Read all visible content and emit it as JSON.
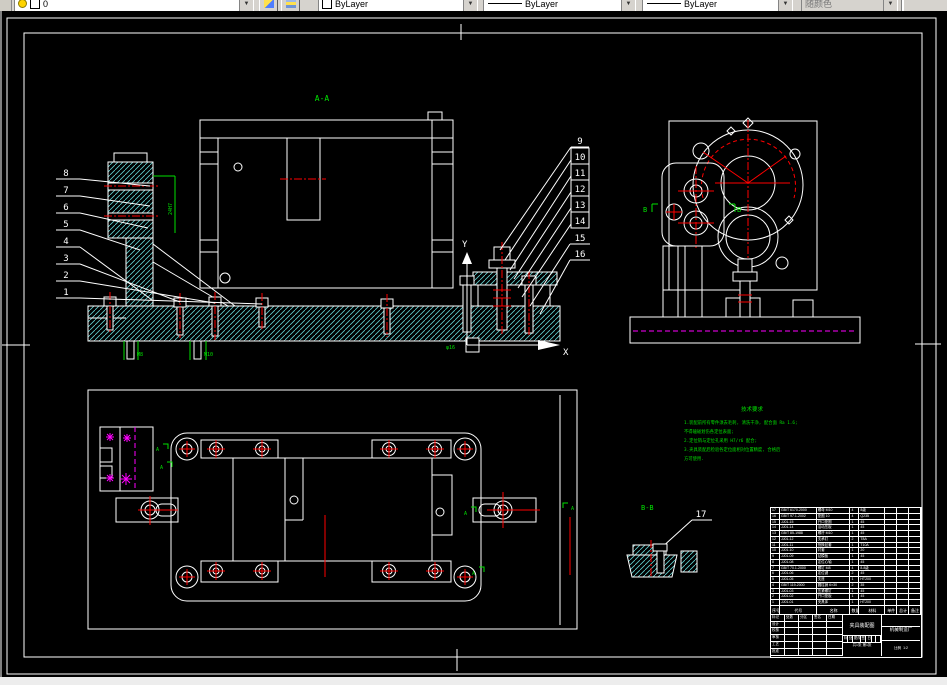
{
  "toolbar": {
    "layer_value": "0",
    "color_value": "ByLayer",
    "linetype_value": "ByLayer",
    "lineweight_value": "ByLayer",
    "plotstyle_value": "随颜色"
  },
  "labels": {
    "section_front": "A-A",
    "section_detail": "B-B",
    "axis_x": "X",
    "axis_y": "Y",
    "side_section": "B",
    "plan_section": "A"
  },
  "balloons": {
    "left": [
      "8",
      "7",
      "6",
      "5",
      "4",
      "3",
      "2",
      "1"
    ],
    "right": [
      "9",
      "10",
      "11",
      "12",
      "13",
      "14",
      "15",
      "16"
    ],
    "detail": "17"
  },
  "dims": {
    "stack": "24H7",
    "base_left": "M8",
    "base_right": "M10",
    "clamp": "φ16"
  },
  "notes": {
    "title": "技术要求",
    "lines": [
      "1.装配前所有零件须去毛刺, 清洗干净, 配合面 Ra 1.6;",
      "不得磕碰划伤各定位表面;",
      "2.定位销与定位孔采用 H7/r6 配合;",
      "3.夹具装配后检验各定位面相对位置精度, 合格后",
      "方可使用."
    ]
  },
  "title_block": {
    "bom_header_rows": [
      [
        "序号",
        "代号",
        "名称",
        "数量",
        "材料",
        "单件",
        "总计",
        "备注"
      ]
    ],
    "bom_rows": [
      [
        "17",
        "GB/T 6170-2000",
        "螺母 M10",
        "4",
        "8级",
        "",
        "",
        ""
      ],
      [
        "16",
        "GB/T 97.1-2002",
        "垫圈 10",
        "4",
        "Q235",
        "",
        "",
        ""
      ],
      [
        "15",
        "JJ01-15",
        "开口垫圈",
        "1",
        "45",
        "",
        "",
        ""
      ],
      [
        "14",
        "JJ01-14",
        "活动压板",
        "1",
        "45",
        "",
        "",
        ""
      ],
      [
        "13",
        "GB/T 85-1988",
        "螺杆 M10",
        "1",
        "45",
        "",
        "",
        ""
      ],
      [
        "12",
        "JJ01-12",
        "支承钉",
        "2",
        "T8A",
        "",
        "",
        ""
      ],
      [
        "11",
        "JJ01-11",
        "快换钻套",
        "1",
        "T10A",
        "",
        "",
        ""
      ],
      [
        "10",
        "JJ01-10",
        "衬套",
        "1",
        "20",
        "",
        "",
        ""
      ],
      [
        "9",
        "JJ01-09",
        "钻模板",
        "1",
        "45",
        "",
        "",
        ""
      ],
      [
        "8",
        "JJ01-08",
        "定位心轴",
        "1",
        "45",
        "",
        "",
        ""
      ],
      [
        "7",
        "GB/T 70.1-2000",
        "螺钉 M8",
        "4",
        "8.8级",
        "",
        "",
        ""
      ],
      [
        "6",
        "JJ01-06",
        "定位键",
        "2",
        "45",
        "",
        "",
        ""
      ],
      [
        "5",
        "JJ01-05",
        "支座",
        "1",
        "HT200",
        "",
        "",
        ""
      ],
      [
        "4",
        "GB/T 119-2000",
        "圆柱销 6×30",
        "2",
        "35",
        "",
        "",
        ""
      ],
      [
        "3",
        "JJ01-03",
        "压紧螺钉",
        "1",
        "45",
        "",
        "",
        ""
      ],
      [
        "2",
        "JJ01-02",
        "开口垫板",
        "1",
        "45",
        "",
        "",
        ""
      ],
      [
        "1",
        "JJ01-01",
        "夹具体",
        "1",
        "HT200",
        "",
        "",
        ""
      ]
    ],
    "left_grid": [
      [
        "标记",
        "处数",
        "分区",
        "签名",
        "日期"
      ],
      [
        "设计",
        "",
        "",
        "",
        ""
      ],
      [
        "校核",
        "",
        "",
        "",
        ""
      ],
      [
        "审核",
        "",
        "",
        "",
        ""
      ],
      [
        "工艺",
        "",
        "",
        "",
        ""
      ],
      [
        "批准",
        "",
        "",
        "",
        ""
      ]
    ],
    "mini_rows": [
      [
        "标记",
        "处数",
        "更改",
        "签名",
        "日期",
        "",
        ""
      ]
    ],
    "drawing_title": "夹具装配图",
    "company": "机械制造厂",
    "scale_label": "比例",
    "scale_value": "1:2",
    "sheet_label": "共1张 第1张"
  },
  "colors": {
    "background": "#000000",
    "line": "#ffffff",
    "centerline": "#ff0000",
    "hatch": "#62cfcf",
    "annotation": "#00e000",
    "aux": "#ff00ff",
    "toolbar_bg": "#d6d3ce"
  }
}
